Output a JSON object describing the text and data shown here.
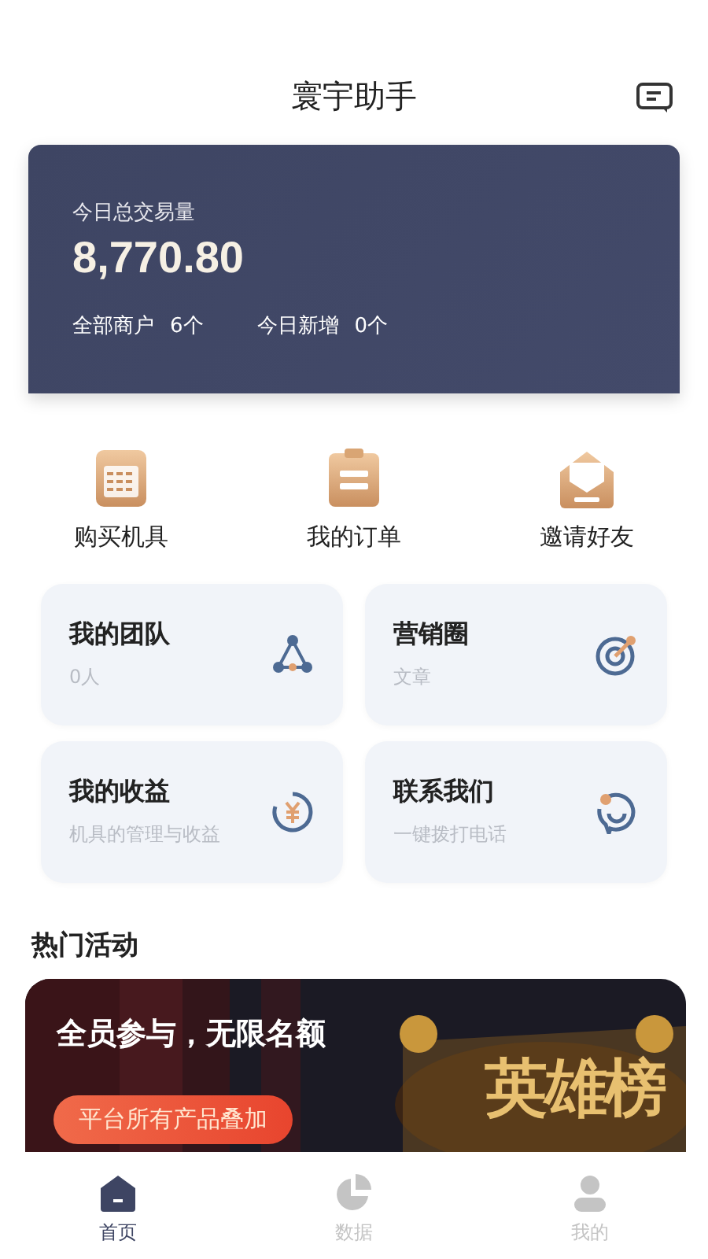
{
  "header": {
    "title": "寰宇助手"
  },
  "summary": {
    "label": "今日总交易量",
    "amount": "8,770.80",
    "stats": [
      {
        "label": "全部商户",
        "value": "6个"
      },
      {
        "label": "今日新增",
        "value": "0个"
      }
    ]
  },
  "shortcuts": [
    {
      "kind": "calculator",
      "label": "购买机具"
    },
    {
      "kind": "clipboard",
      "label": "我的订单"
    },
    {
      "kind": "envelope",
      "label": "邀请好友"
    }
  ],
  "tiles": [
    {
      "kind": "team",
      "title": "我的团队",
      "subtitle": "0人"
    },
    {
      "kind": "target",
      "title": "营销圈",
      "subtitle": "文章"
    },
    {
      "kind": "yen",
      "title": "我的收益",
      "subtitle": "机具的管理与收益"
    },
    {
      "kind": "chat",
      "title": "联系我们",
      "subtitle": "一键拨打电话"
    }
  ],
  "section_title": "热门活动",
  "banner": {
    "headline": "全员参与，无限名额",
    "button": "平台所有产品叠加",
    "emblem": "英雄榜"
  },
  "tab_bar": [
    {
      "kind": "home",
      "label": "首页",
      "selected": true
    },
    {
      "kind": "pie",
      "label": "数据",
      "selected": false
    },
    {
      "kind": "user",
      "label": "我的",
      "selected": false
    }
  ]
}
